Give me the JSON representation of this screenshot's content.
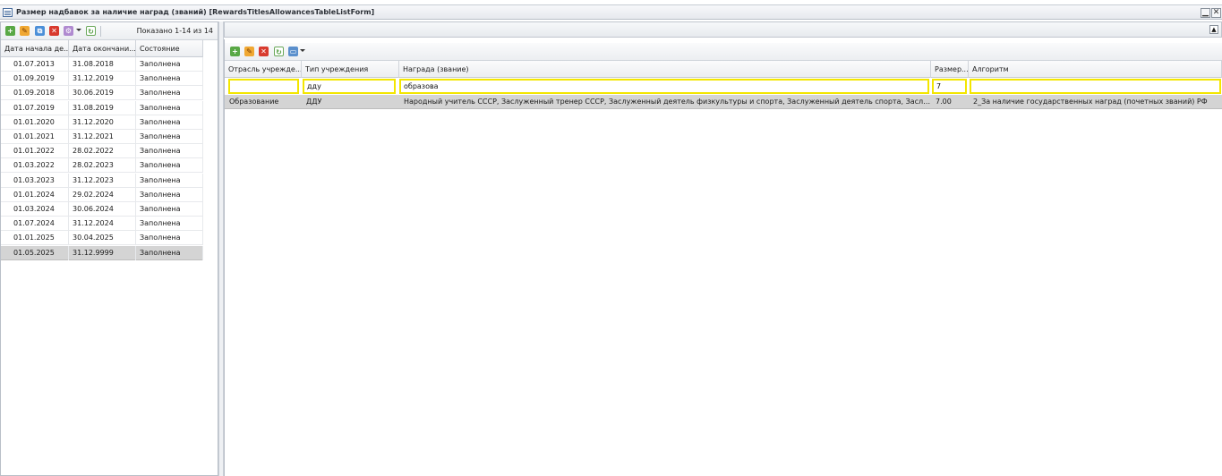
{
  "window": {
    "title": "Размер надбавок за наличие наград (званий) [RewardsTitlesAllowancesTableListForm]",
    "minimize_glyph": "▁",
    "close_glyph": "✕"
  },
  "left": {
    "paging_text": "Показано 1-14 из 14",
    "columns": [
      "Дата начала де...",
      "Дата окончани...",
      "Состояние"
    ],
    "rows": [
      {
        "start": "01.07.2013",
        "end": "31.08.2018",
        "state": "Заполнена"
      },
      {
        "start": "01.09.2019",
        "end": "31.12.2019",
        "state": "Заполнена"
      },
      {
        "start": "01.09.2018",
        "end": "30.06.2019",
        "state": "Заполнена"
      },
      {
        "start": "01.07.2019",
        "end": "31.08.2019",
        "state": "Заполнена"
      },
      {
        "start": "01.01.2020",
        "end": "31.12.2020",
        "state": "Заполнена"
      },
      {
        "start": "01.01.2021",
        "end": "31.12.2021",
        "state": "Заполнена"
      },
      {
        "start": "01.01.2022",
        "end": "28.02.2022",
        "state": "Заполнена"
      },
      {
        "start": "01.03.2022",
        "end": "28.02.2023",
        "state": "Заполнена"
      },
      {
        "start": "01.03.2023",
        "end": "31.12.2023",
        "state": "Заполнена"
      },
      {
        "start": "01.01.2024",
        "end": "29.02.2024",
        "state": "Заполнена"
      },
      {
        "start": "01.03.2024",
        "end": "30.06.2024",
        "state": "Заполнена"
      },
      {
        "start": "01.07.2024",
        "end": "31.12.2024",
        "state": "Заполнена"
      },
      {
        "start": "01.01.2025",
        "end": "30.04.2025",
        "state": "Заполнена"
      },
      {
        "start": "01.05.2025",
        "end": "31.12.9999",
        "state": "Заполнена"
      }
    ],
    "selected_row": 13
  },
  "right": {
    "collapse_glyph": "▲",
    "columns": [
      "Отрасль учрежде...",
      "Тип учреждения",
      "Награда (звание)",
      "Размер...",
      "Алгоритм"
    ],
    "filters": {
      "branch": "",
      "type": "дду",
      "award": "образова",
      "size": "7",
      "algorithm": ""
    },
    "row": {
      "branch": "Образование",
      "type": "ДДУ",
      "award": "Народный учитель СССР, Заслуженный тренер СССР, Заслуженный деятель физкультуры и спорта, Заслуженный деятель спорта, Заслуженный деяте...",
      "size": "7.00",
      "algorithm": "2_За наличие государственных наград (почетных званий) РФ"
    }
  },
  "icons": {
    "add": "add-icon",
    "edit": "edit-icon",
    "copy": "copy-icon",
    "delete": "delete-icon",
    "misc": "misc-icon",
    "refresh": "refresh-icon",
    "print": "print-icon"
  },
  "colors": {
    "selected_row": "#d4d4d4",
    "filter_border": "#f3e600",
    "add": "#59a845",
    "delete": "#d83a2e",
    "edit": "#f0a833",
    "copy": "#4b8fd8"
  }
}
